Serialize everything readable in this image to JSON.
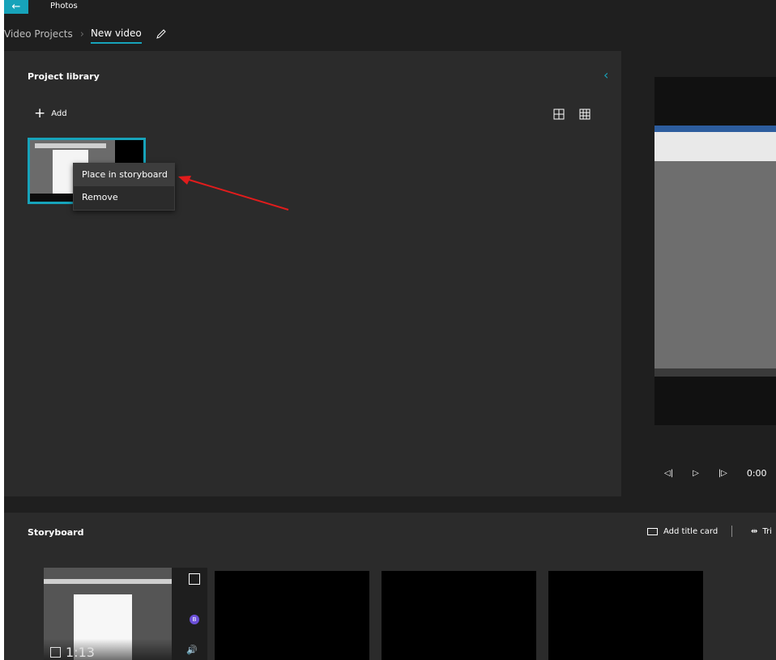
{
  "app": {
    "title": "Photos",
    "back_icon": "back-arrow-icon",
    "accent": "#17a3ba"
  },
  "breadcrumb": {
    "parent": "Video Projects",
    "current": "New video",
    "rename_icon": "pencil-icon"
  },
  "library": {
    "title": "Project library",
    "add_label": "Add",
    "view_modes": [
      "large-grid-icon",
      "small-grid-icon"
    ],
    "active_view": "small-grid-icon"
  },
  "context_menu": {
    "items": [
      "Place in storyboard",
      "Remove"
    ],
    "highlighted": "Place in storyboard"
  },
  "preview": {
    "controls": [
      "rewind-icon",
      "play-icon",
      "step-forward-icon"
    ],
    "time": "0:00"
  },
  "storyboard": {
    "title": "Storyboard",
    "add_title_card": "Add title card",
    "trim_label": "Tri",
    "clips": [
      {
        "duration": "1:13",
        "badge": "B"
      }
    ],
    "empty_slots": 3
  }
}
